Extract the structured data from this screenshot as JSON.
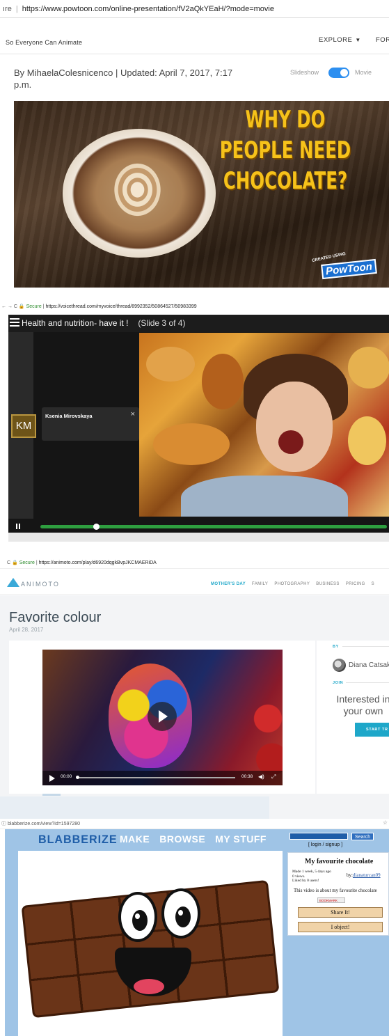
{
  "powtoon": {
    "url_prefix": "ıre",
    "url": "https://www.powtoon.com/online-presentation/fV2aQkYEaH/?mode=movie",
    "tagline": "So Everyone Can Animate",
    "nav_explore": "EXPLORE",
    "nav_for": "FOR",
    "byline": "By MihaelaColesnicenco | Updated: April 7, 2017, 7:17 p.m.",
    "toggle_left": "Slideshow",
    "toggle_right": "Movie",
    "toggle_state": "movie",
    "slide_headline_1": "WHY DO",
    "slide_headline_2": "PEOPLE NEED",
    "slide_headline_3": "CHOCOLATE?",
    "badge_small": "CREATED USING",
    "badge_logo": "PowToon",
    "colors": {
      "toggle": "#2d8ff0",
      "headline": "#f6c21a"
    }
  },
  "voicethread": {
    "url_secure": "Secure",
    "url": "https://voicethread.com/myvoice/thread/8992352/50864527/50983399",
    "title": "Health and nutrition- have it !",
    "slide_indicator": "(Slide 3 of 4)",
    "avatar_initials": "KM",
    "commenter_name": "Ksenia  Mirovskaya",
    "progress": 0.16,
    "colors": {
      "progress": "#2e9e3f"
    }
  },
  "animoto": {
    "url_secure": "Secure",
    "url": "https://animoto.com/play/d6920dqgkBvpJKCMAERiDA",
    "logo": "ANIMOTO",
    "nav": [
      "MOTHER'S DAY",
      "FAMILY",
      "PHOTOGRAPHY",
      "BUSINESS",
      "PRICING",
      "S"
    ],
    "video_title": "Favorite colour",
    "video_date": "April 28, 2017",
    "time_current": "00:00",
    "time_total": "00:38",
    "by_label": "BY",
    "author": "Diana Catsak",
    "join_label": "JOIN",
    "interested_line1": "Interested in",
    "interested_line2": "your own",
    "start_button": "START TR",
    "colors": {
      "accent": "#1ea7c9"
    }
  },
  "blabberize": {
    "url": "blabberize.com/view?id=1597280",
    "logo": "BLABBERIZE",
    "nav": [
      "MAKE",
      "BROWSE",
      "MY STUFF"
    ],
    "search_button": "Search",
    "login_link": "[ login / signup ]",
    "video_title": "My favourite chocolate",
    "meta_made": "Made 1 week, 5 days ago",
    "meta_views": "0 views.",
    "meta_liked": "Liked by 0 users!",
    "by_prefix": "by:",
    "by_user": "dianaturcan09",
    "description": "This video is about my favourite chocolate",
    "bookmark": "BOOKMARK",
    "share_button": "Share It!",
    "object_button": "I object!",
    "colors": {
      "background": "#9fc4e6",
      "button": "#f0d3a8"
    }
  }
}
